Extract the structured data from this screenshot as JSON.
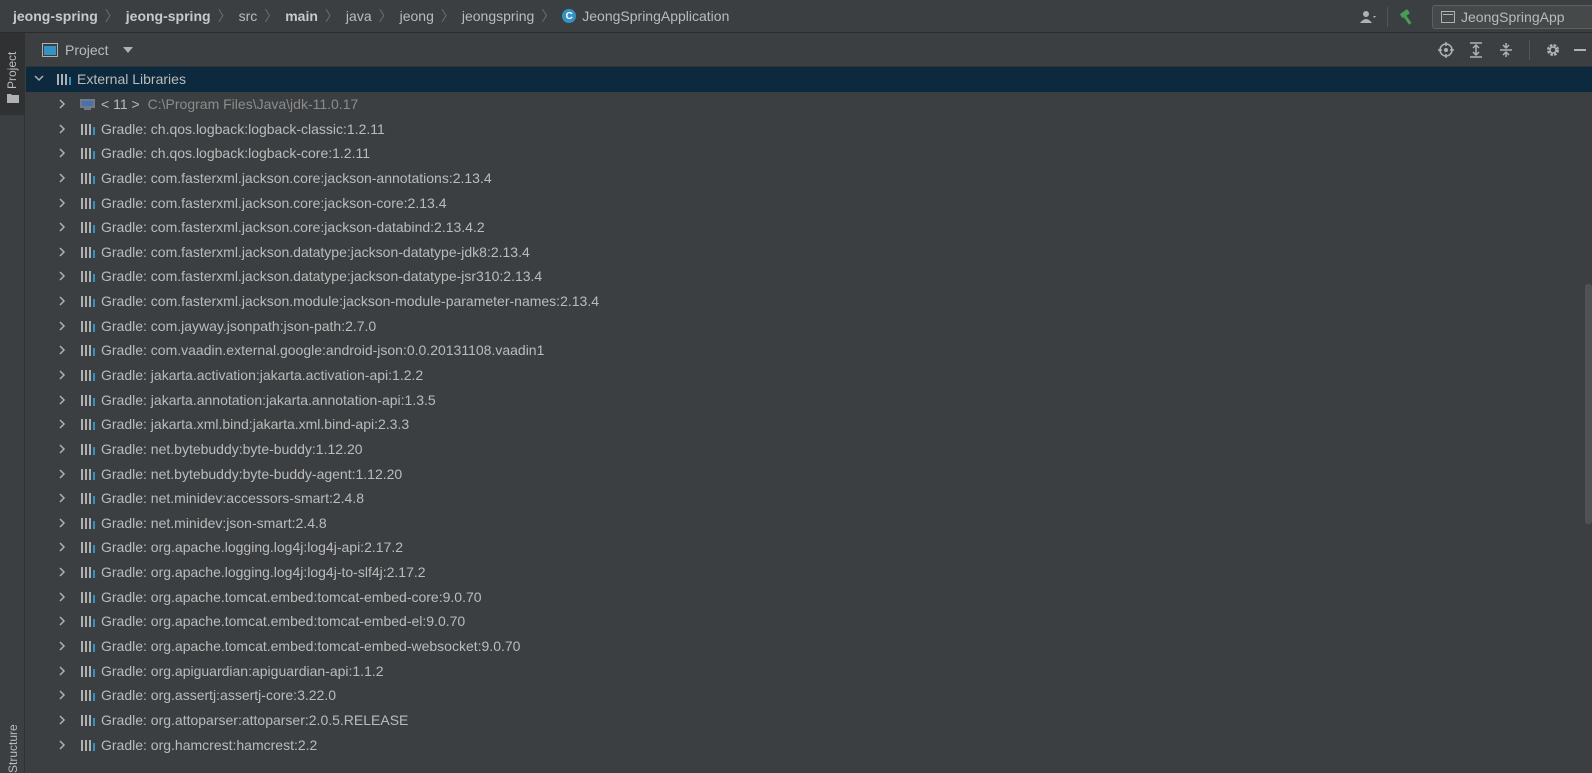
{
  "breadcrumb": {
    "items": [
      "jeong-spring",
      "jeong-spring",
      "src",
      "main",
      "java",
      "jeong",
      "jeongspring",
      "JeongSpringApplication"
    ]
  },
  "toolbar": {
    "run_config_label": "JeongSpringApp"
  },
  "stripe": {
    "project_tab": "Project",
    "structure_tab": "Structure"
  },
  "tool_window": {
    "title": "Project"
  },
  "tree": {
    "root_label": "External Libraries",
    "jdk": {
      "version": "< 11 >",
      "path": "C:\\Program Files\\Java\\jdk-11.0.17"
    },
    "libraries": [
      "Gradle: ch.qos.logback:logback-classic:1.2.11",
      "Gradle: ch.qos.logback:logback-core:1.2.11",
      "Gradle: com.fasterxml.jackson.core:jackson-annotations:2.13.4",
      "Gradle: com.fasterxml.jackson.core:jackson-core:2.13.4",
      "Gradle: com.fasterxml.jackson.core:jackson-databind:2.13.4.2",
      "Gradle: com.fasterxml.jackson.datatype:jackson-datatype-jdk8:2.13.4",
      "Gradle: com.fasterxml.jackson.datatype:jackson-datatype-jsr310:2.13.4",
      "Gradle: com.fasterxml.jackson.module:jackson-module-parameter-names:2.13.4",
      "Gradle: com.jayway.jsonpath:json-path:2.7.0",
      "Gradle: com.vaadin.external.google:android-json:0.0.20131108.vaadin1",
      "Gradle: jakarta.activation:jakarta.activation-api:1.2.2",
      "Gradle: jakarta.annotation:jakarta.annotation-api:1.3.5",
      "Gradle: jakarta.xml.bind:jakarta.xml.bind-api:2.3.3",
      "Gradle: net.bytebuddy:byte-buddy:1.12.20",
      "Gradle: net.bytebuddy:byte-buddy-agent:1.12.20",
      "Gradle: net.minidev:accessors-smart:2.4.8",
      "Gradle: net.minidev:json-smart:2.4.8",
      "Gradle: org.apache.logging.log4j:log4j-api:2.17.2",
      "Gradle: org.apache.logging.log4j:log4j-to-slf4j:2.17.2",
      "Gradle: org.apache.tomcat.embed:tomcat-embed-core:9.0.70",
      "Gradle: org.apache.tomcat.embed:tomcat-embed-el:9.0.70",
      "Gradle: org.apache.tomcat.embed:tomcat-embed-websocket:9.0.70",
      "Gradle: org.apiguardian:apiguardian-api:1.1.2",
      "Gradle: org.assertj:assertj-core:3.22.0",
      "Gradle: org.attoparser:attoparser:2.0.5.RELEASE",
      "Gradle: org.hamcrest:hamcrest:2.2"
    ]
  },
  "colors": {
    "background": "#3c3f41",
    "selection": "#0d293e",
    "text": "#bbbbbb",
    "hammer": "#499c54",
    "class_icon": "#3592c4"
  },
  "icons": {
    "project_view": "project-view-icon",
    "locate": "crosshair-icon",
    "expand_all": "expand-all-icon",
    "collapse_all": "collapse-all-icon",
    "settings": "gear-icon",
    "hide": "minimize-icon",
    "build": "hammer-icon",
    "vcs_user": "user-icon",
    "library": "library-icon",
    "jdk": "jdk-icon"
  }
}
